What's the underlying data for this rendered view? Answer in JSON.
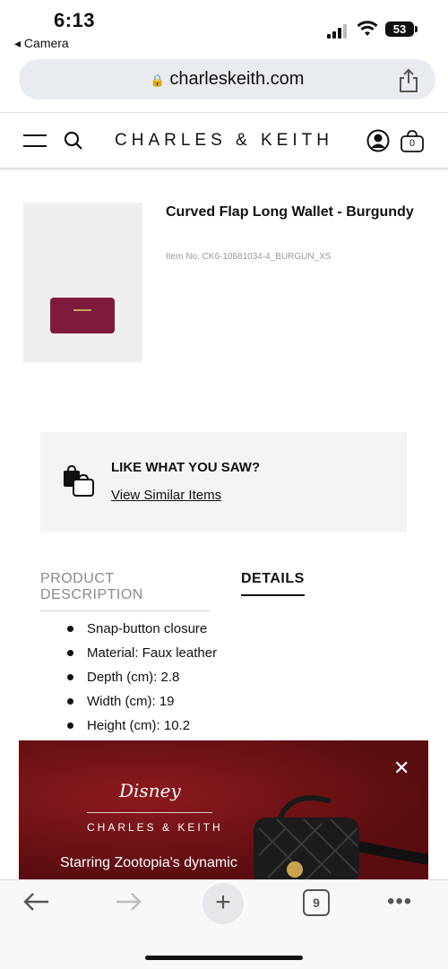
{
  "status": {
    "time": "6:13",
    "back_app": "◂ Camera",
    "battery": "53"
  },
  "browser": {
    "url": "charleskeith.com",
    "tab_count": "9"
  },
  "header": {
    "logo": "CHARLES & KEITH",
    "cart_count": "0"
  },
  "product": {
    "name": "Curved Flap Long Wallet - Burgundy",
    "item_no": "Item No. CK6-10681034-4_BURGUN_XS",
    "color": "#7e1b3c"
  },
  "similar": {
    "title": "LIKE WHAT YOU SAW?",
    "link": "View Similar Items"
  },
  "tabs": {
    "description": "PRODUCT DESCRIPTION",
    "details": "DETAILS"
  },
  "details": [
    "Snap-button closure",
    "Material: Faux leather",
    "Depth (cm): 2.8",
    "Width (cm): 19",
    "Height (cm): 10.2"
  ],
  "promo": {
    "brand": "Disney",
    "partner": "CHARLES & KEITH",
    "tagline": "Starring Zootopia's dynamic",
    "bg_color": "#6b1114"
  }
}
